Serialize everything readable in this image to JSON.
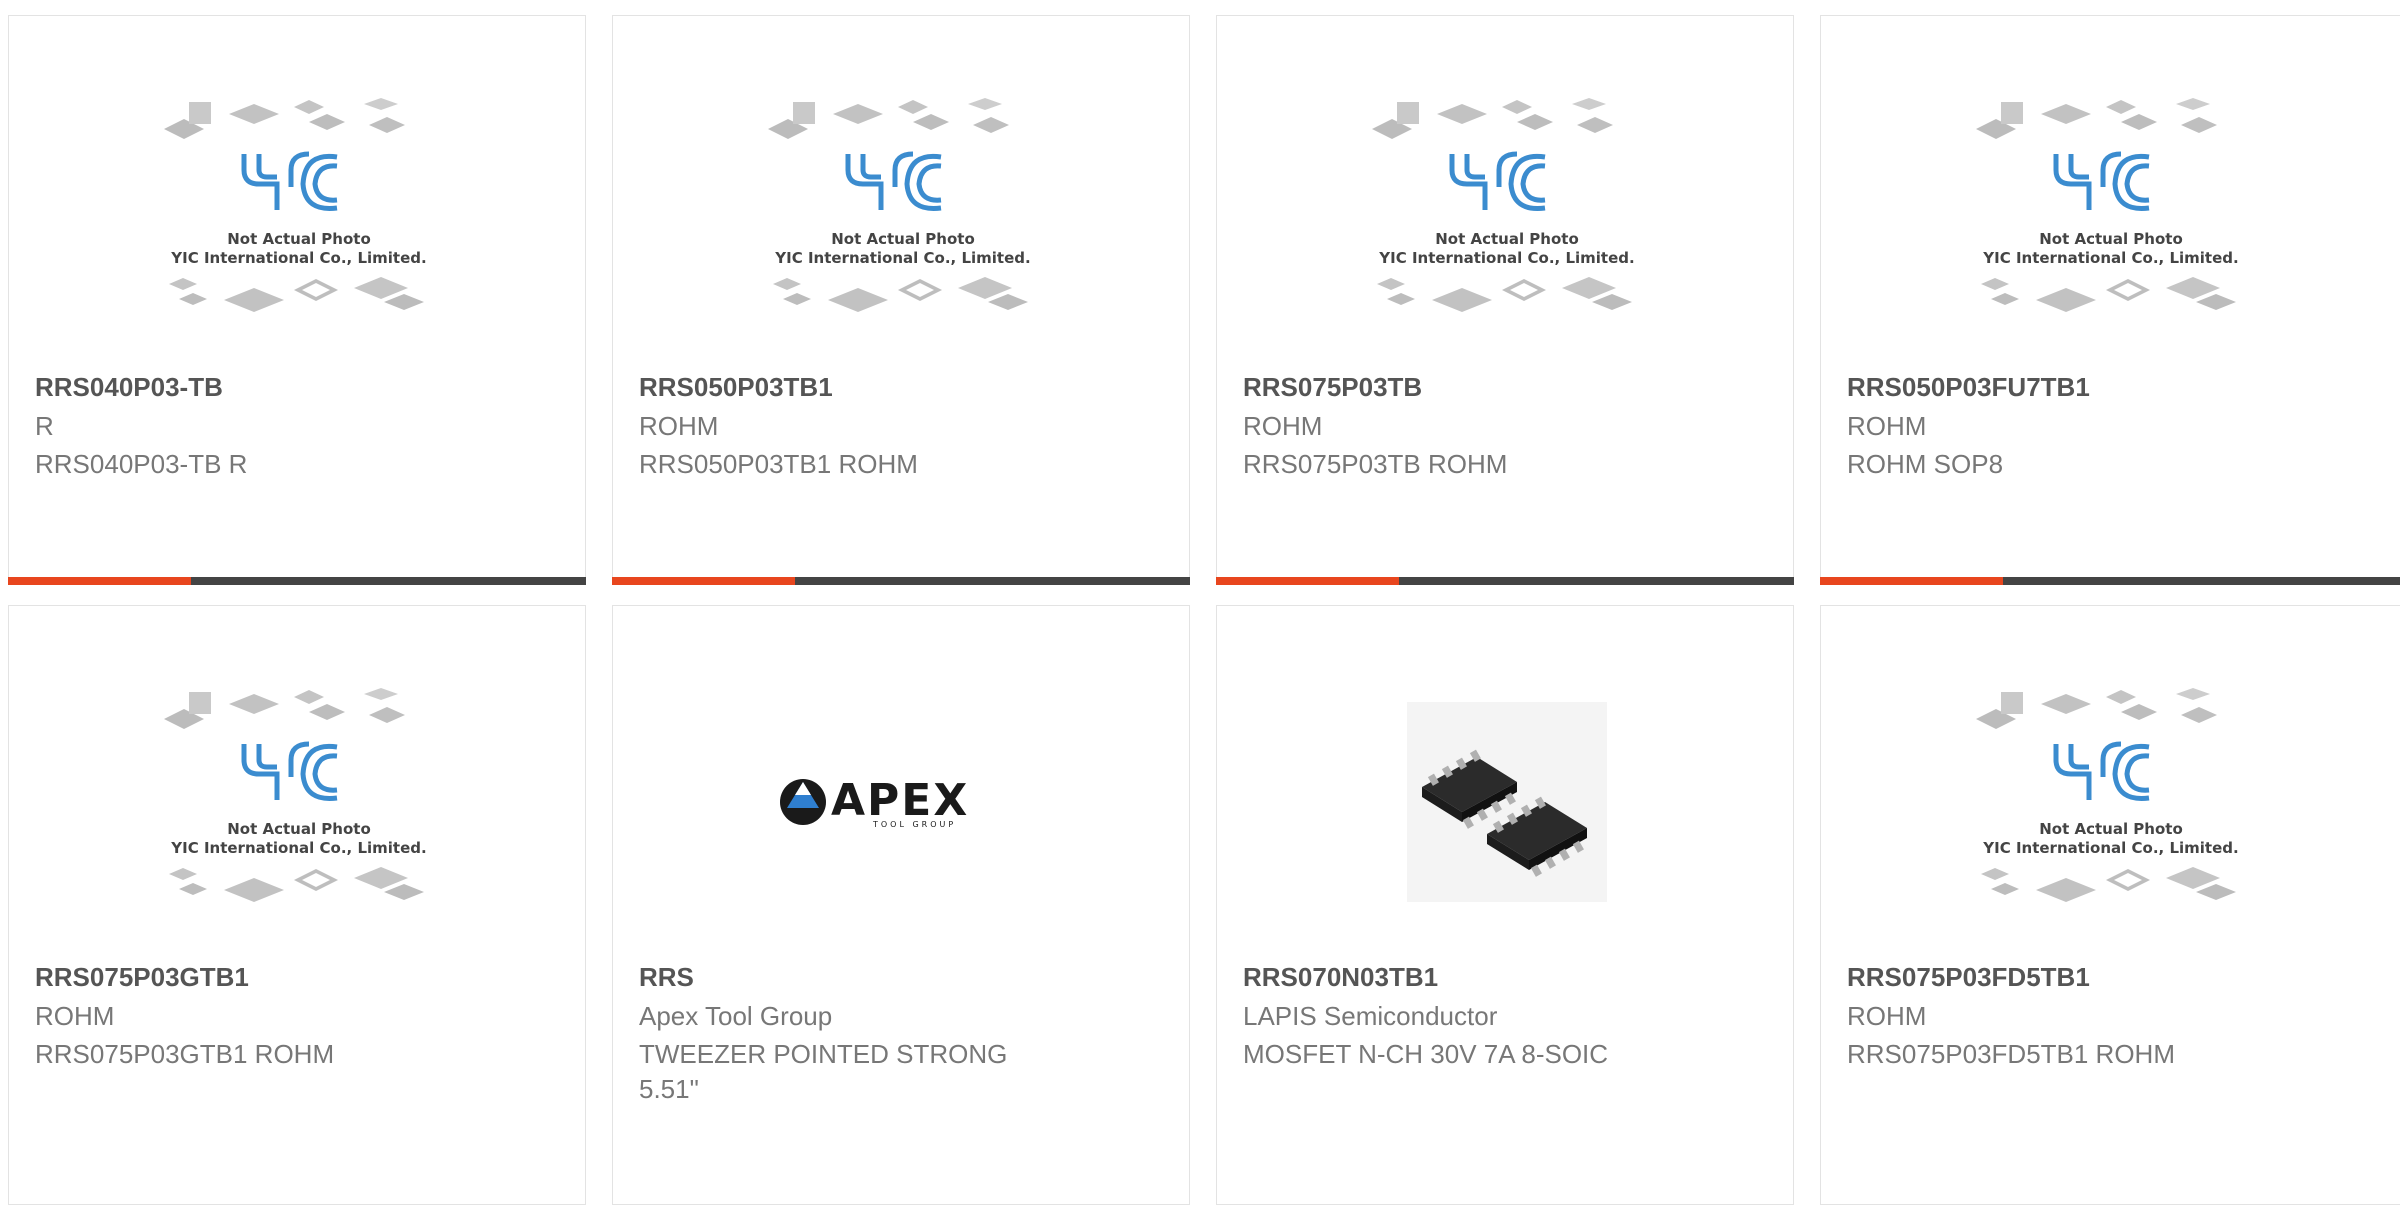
{
  "colors": {
    "accent": "#e8461e",
    "bar": "#444444",
    "title": "#555555",
    "text": "#777777",
    "yic_blue": "#3b8ccf"
  },
  "placeholder": {
    "logo_text": "YIC",
    "line1": "Not Actual Photo",
    "line2": "YIC International Co., Limited."
  },
  "apex": {
    "logo_text": "APEX",
    "sub_text": "TOOL GROUP"
  },
  "products": [
    {
      "part": "RRS040P03-TB",
      "manufacturer": "R",
      "description": "RRS040P03-TB R",
      "image": "yic-placeholder",
      "active": true
    },
    {
      "part": "RRS050P03TB1",
      "manufacturer": "ROHM",
      "description": "RRS050P03TB1 ROHM",
      "image": "yic-placeholder",
      "active": true
    },
    {
      "part": "RRS075P03TB",
      "manufacturer": "ROHM",
      "description": "RRS075P03TB ROHM",
      "image": "yic-placeholder",
      "active": true
    },
    {
      "part": "RRS050P03FU7TB1",
      "manufacturer": "ROHM",
      "description": "ROHM SOP8",
      "image": "yic-placeholder",
      "active": true
    },
    {
      "part": "RRS075P03GTB1",
      "manufacturer": "ROHM",
      "description": "RRS075P03GTB1 ROHM",
      "image": "yic-placeholder",
      "active": false
    },
    {
      "part": "RRS",
      "manufacturer": "Apex Tool Group",
      "description": "TWEEZER POINTED STRONG 5.51\"",
      "image": "apex-logo",
      "active": false
    },
    {
      "part": "RRS070N03TB1",
      "manufacturer": "LAPIS Semiconductor",
      "description": "MOSFET N-CH 30V 7A 8-SOIC",
      "image": "soic-chip-photo",
      "active": false
    },
    {
      "part": "RRS075P03FD5TB1",
      "manufacturer": "ROHM",
      "description": "RRS075P03FD5TB1 ROHM",
      "image": "yic-placeholder",
      "active": false
    }
  ]
}
